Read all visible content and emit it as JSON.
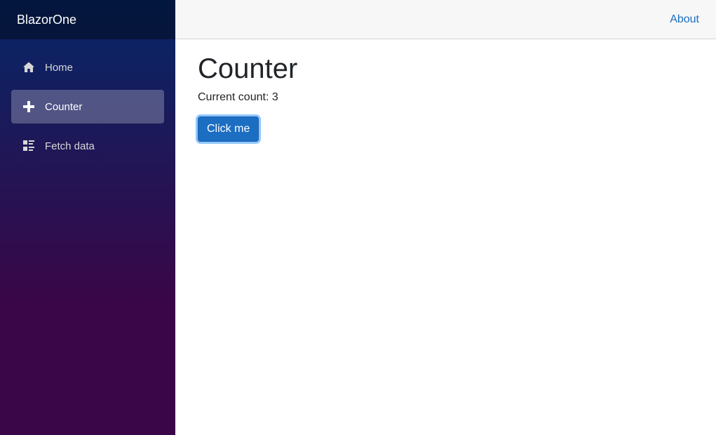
{
  "sidebar": {
    "brand": "BlazorOne",
    "items": [
      {
        "label": "Home",
        "icon": "home-icon",
        "active": false
      },
      {
        "label": "Counter",
        "icon": "plus-icon",
        "active": true
      },
      {
        "label": "Fetch data",
        "icon": "list-rich-icon",
        "active": false
      }
    ]
  },
  "header": {
    "about_label": "About"
  },
  "main": {
    "title": "Counter",
    "count_label": "Current count: 3",
    "button_label": "Click me"
  },
  "colors": {
    "accent": "#1b6ec2",
    "sidebar_top": "#052767",
    "sidebar_bottom": "#3a0647"
  }
}
